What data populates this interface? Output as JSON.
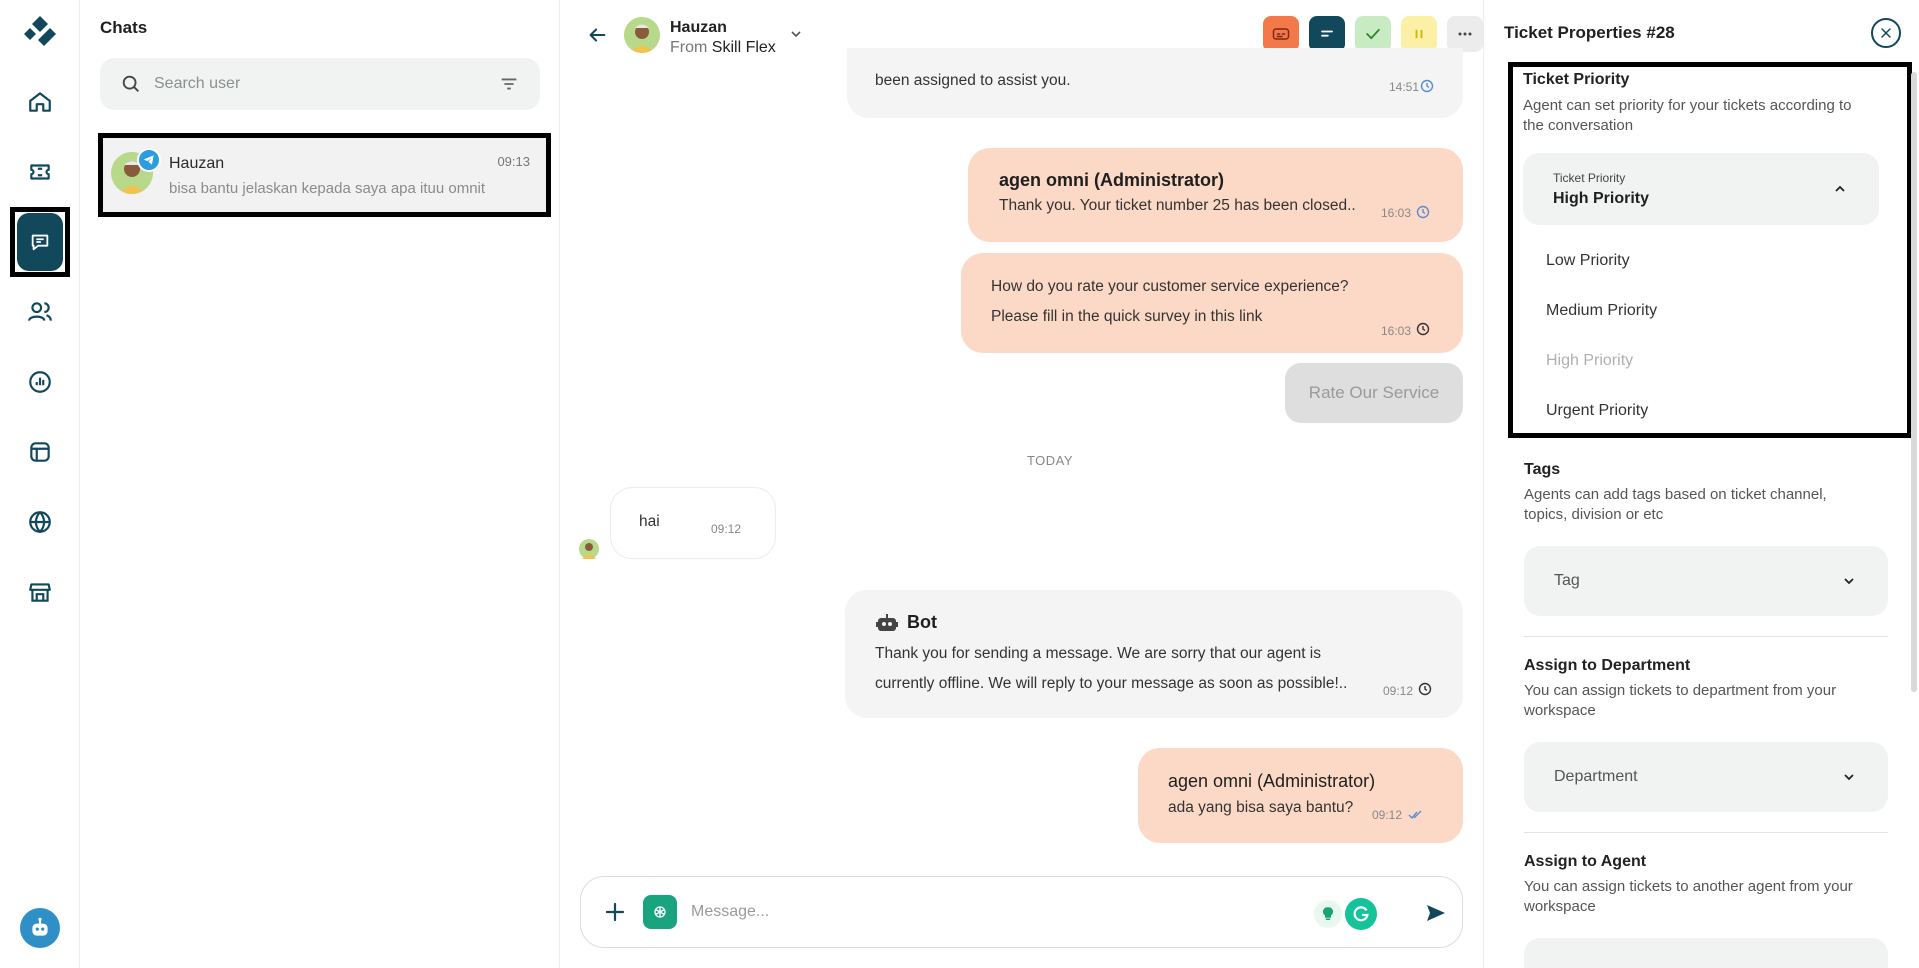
{
  "chatlist": {
    "title": "Chats",
    "search_placeholder": "Search user",
    "item": {
      "name": "Hauzan",
      "time": "09:13",
      "preview": "bisa bantu jelaskan kepada saya apa ituu omnit"
    }
  },
  "header": {
    "name": "Hauzan",
    "from_prefix": "From",
    "from_source": "Skill Flex"
  },
  "messages": {
    "m0_text": "been assigned to assist you.",
    "m0_time": "14:51",
    "m1_sender": "agen omni (Administrator)",
    "m1_text": "Thank you. Your ticket number 25 has been closed..",
    "m1_time": "16:03",
    "m2_line1": "How do you rate your customer service experience?",
    "m2_line2": "Please fill in the quick survey in this link",
    "m2_time": "16:03",
    "rate_button": "Rate Our Service",
    "date_divider": "TODAY",
    "m3_text": "hai",
    "m3_time": "09:12",
    "m4_sender": "Bot",
    "m4_line1": "Thank you for sending a message. We are sorry that our agent is",
    "m4_line2": "currently offline. We will reply to your message as soon as possible!..",
    "m4_time": "09:12",
    "m5_sender": "agen omni (Administrator)",
    "m5_text": "ada yang bisa saya bantu?",
    "m5_time": "09:12"
  },
  "composer": {
    "placeholder": "Message..."
  },
  "panel": {
    "title": "Ticket Properties #28",
    "priority": {
      "title": "Ticket Priority",
      "desc_line1": "Agent can set priority for your tickets according to",
      "desc_line2": "the conversation",
      "select_label": "Ticket Priority",
      "selected": "High Priority",
      "options": [
        "Low Priority",
        "Medium Priority",
        "High Priority",
        "Urgent Priority"
      ]
    },
    "tags": {
      "title": "Tags",
      "desc_line1": "Agents can add tags based on ticket channel,",
      "desc_line2": "topics, division or etc",
      "placeholder": "Tag"
    },
    "department": {
      "title": "Assign to Department",
      "desc_line1": "You can assign tickets to department from your",
      "desc_line2": "workspace",
      "placeholder": "Department"
    },
    "agent": {
      "title": "Assign to Agent",
      "desc_line1": "You can assign tickets to another agent from your",
      "desc_line2": "workspace"
    }
  },
  "colors": {
    "brand": "#11485c",
    "outgoing_bubble": "#fcd9c6",
    "incoming_bubble": "#f4f4f4",
    "action_orange": "#f4794a",
    "action_green": "#c9ebc4",
    "action_yellow": "#fbf0a6"
  }
}
